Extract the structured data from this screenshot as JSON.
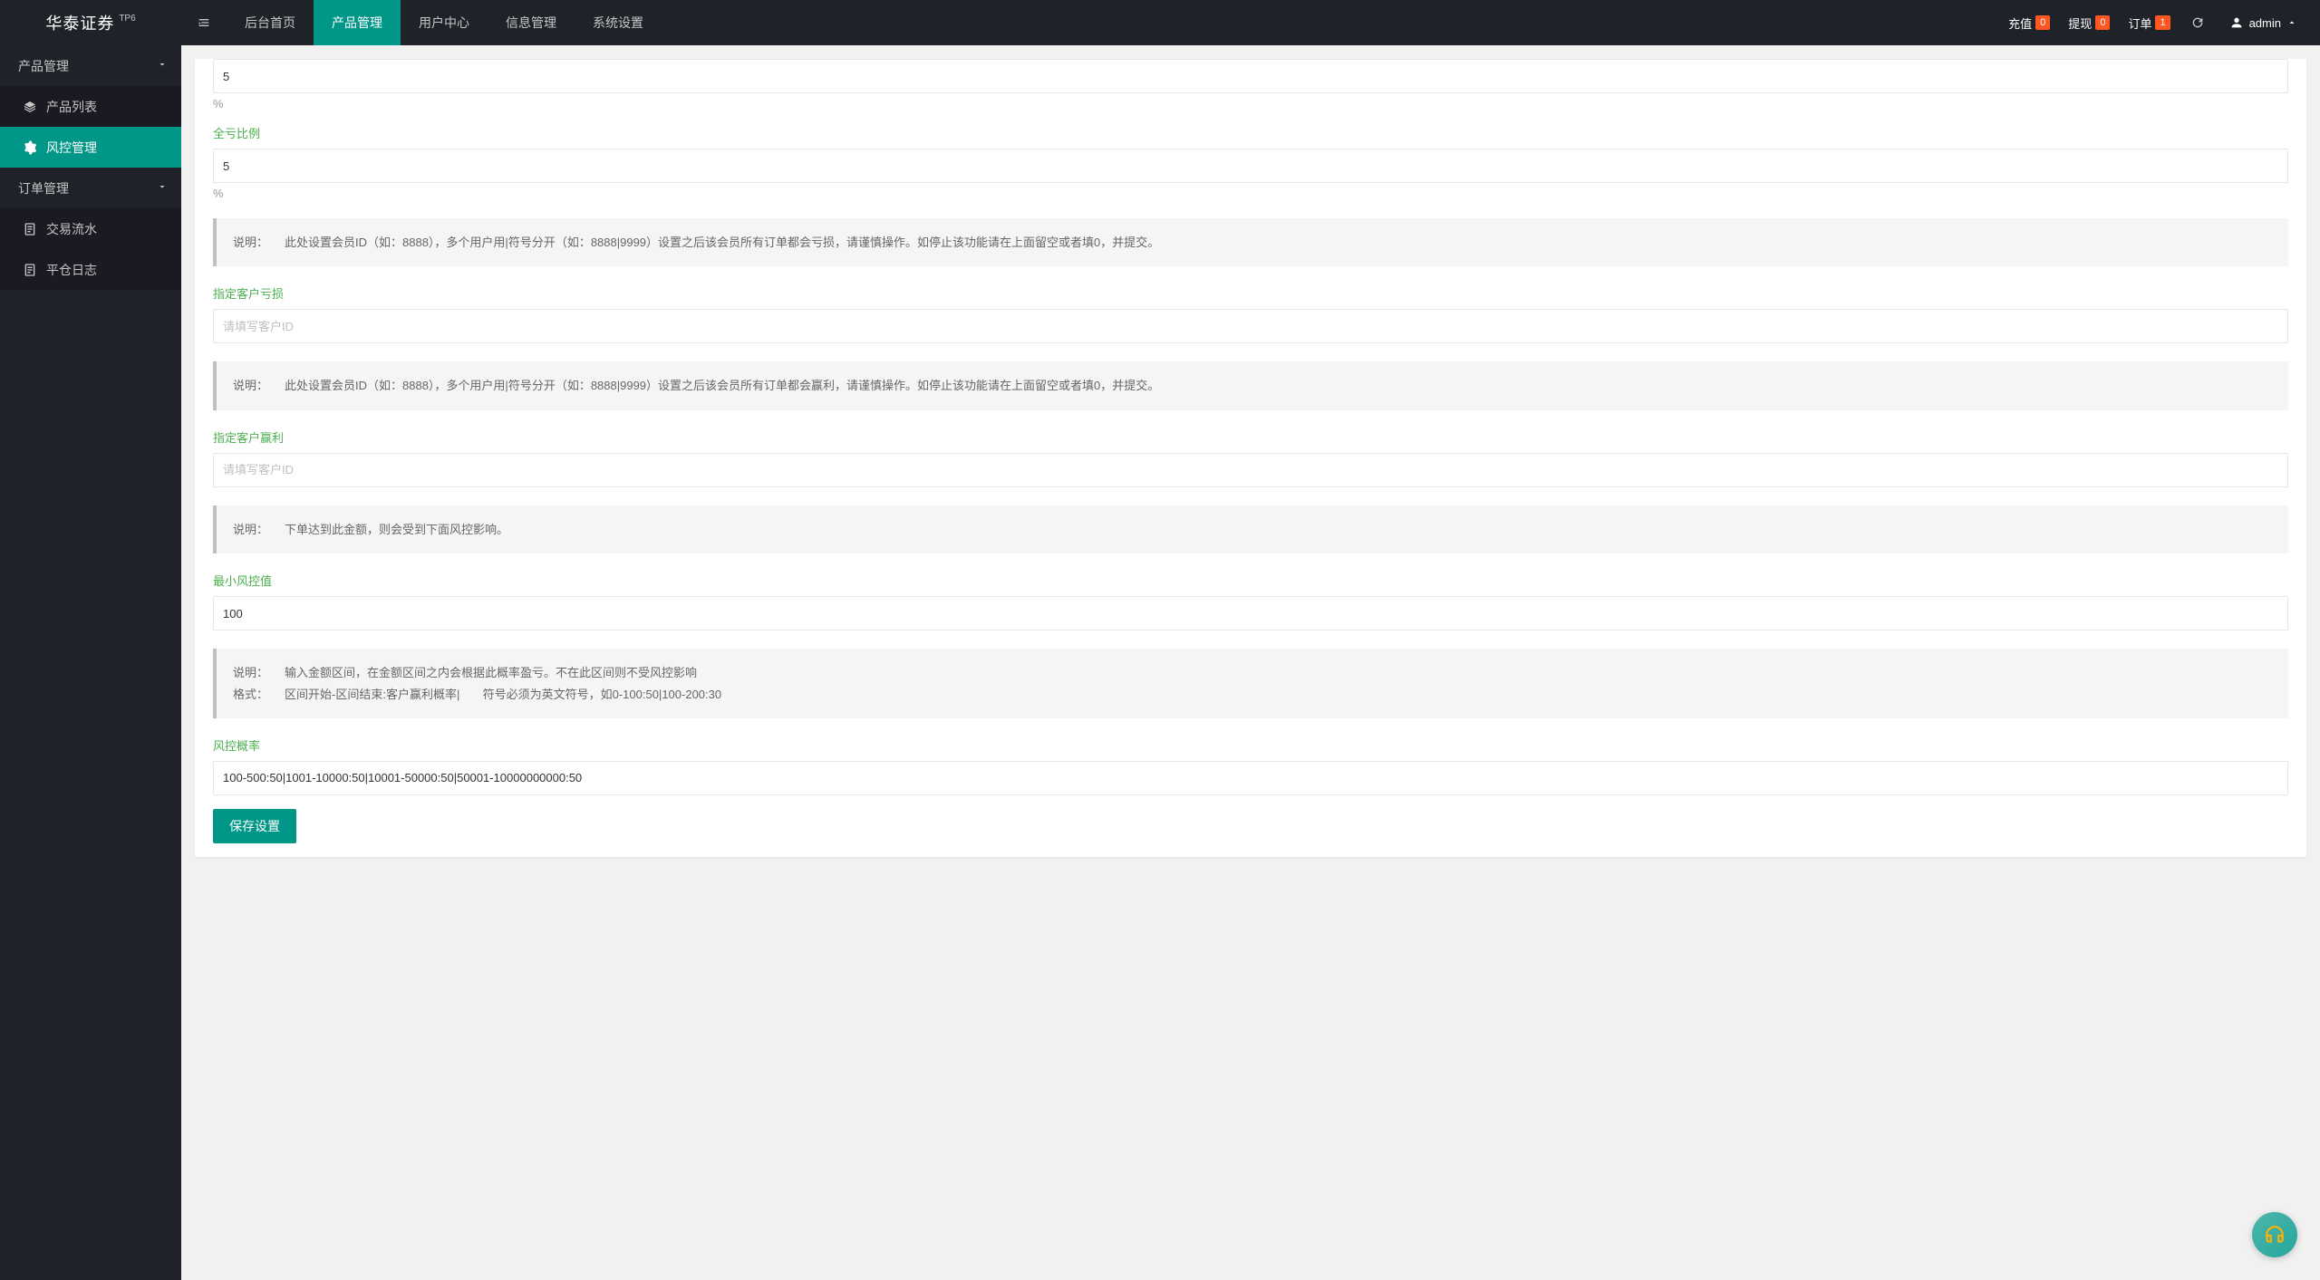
{
  "app": {
    "title": "华泰证券",
    "version": "TP6"
  },
  "nav": {
    "home": "后台首页",
    "products": "产品管理",
    "users": "用户中心",
    "info": "信息管理",
    "system": "系统设置"
  },
  "topbar": {
    "recharge_label": "充值",
    "recharge_count": "0",
    "withdraw_label": "提现",
    "withdraw_count": "0",
    "order_label": "订单",
    "order_count": "1",
    "username": "admin"
  },
  "sidebar": {
    "group_product": "产品管理",
    "item_product_list": "产品列表",
    "item_risk": "风控管理",
    "group_order": "订单管理",
    "item_tx_flow": "交易流水",
    "item_close_log": "平仓日志"
  },
  "form": {
    "field0_value": "5",
    "percent_unit": "%",
    "full_loss_label": "全亏比例",
    "full_loss_value": "5",
    "info1_label": "说明：",
    "info1_text": "此处设置会员ID（如：8888），多个用户用|符号分开（如：8888|9999）设置之后该会员所有订单都会亏损，请谨慎操作。如停止该功能请在上面留空或者填0，并提交。",
    "designated_loss_label": "指定客户亏损",
    "designated_loss_placeholder": "请填写客户ID",
    "designated_loss_value": "",
    "info2_label": "说明：",
    "info2_text": "此处设置会员ID（如：8888），多个用户用|符号分开（如：8888|9999）设置之后该会员所有订单都会赢利，请谨慎操作。如停止该功能请在上面留空或者填0，并提交。",
    "designated_profit_label": "指定客户赢利",
    "designated_profit_placeholder": "请填写客户ID",
    "designated_profit_value": "",
    "info3_label": "说明：",
    "info3_text": "下单达到此金额，则会受到下面风控影响。",
    "min_risk_label": "最小风控值",
    "min_risk_value": "100",
    "info4_label": "说明：",
    "info4_text": "输入金额区间，在金额区间之内会根据此概率盈亏。不在此区间则不受风控影响",
    "info4b_label": "格式：",
    "info4b_text": "区间开始-区间结束:客户赢利概率|       符号必须为英文符号，如0-100:50|100-200:30",
    "risk_prob_label": "风控概率",
    "risk_prob_value": "100-500:50|1001-10000:50|10001-50000:50|50001-10000000000:50",
    "save_btn": "保存设置"
  }
}
